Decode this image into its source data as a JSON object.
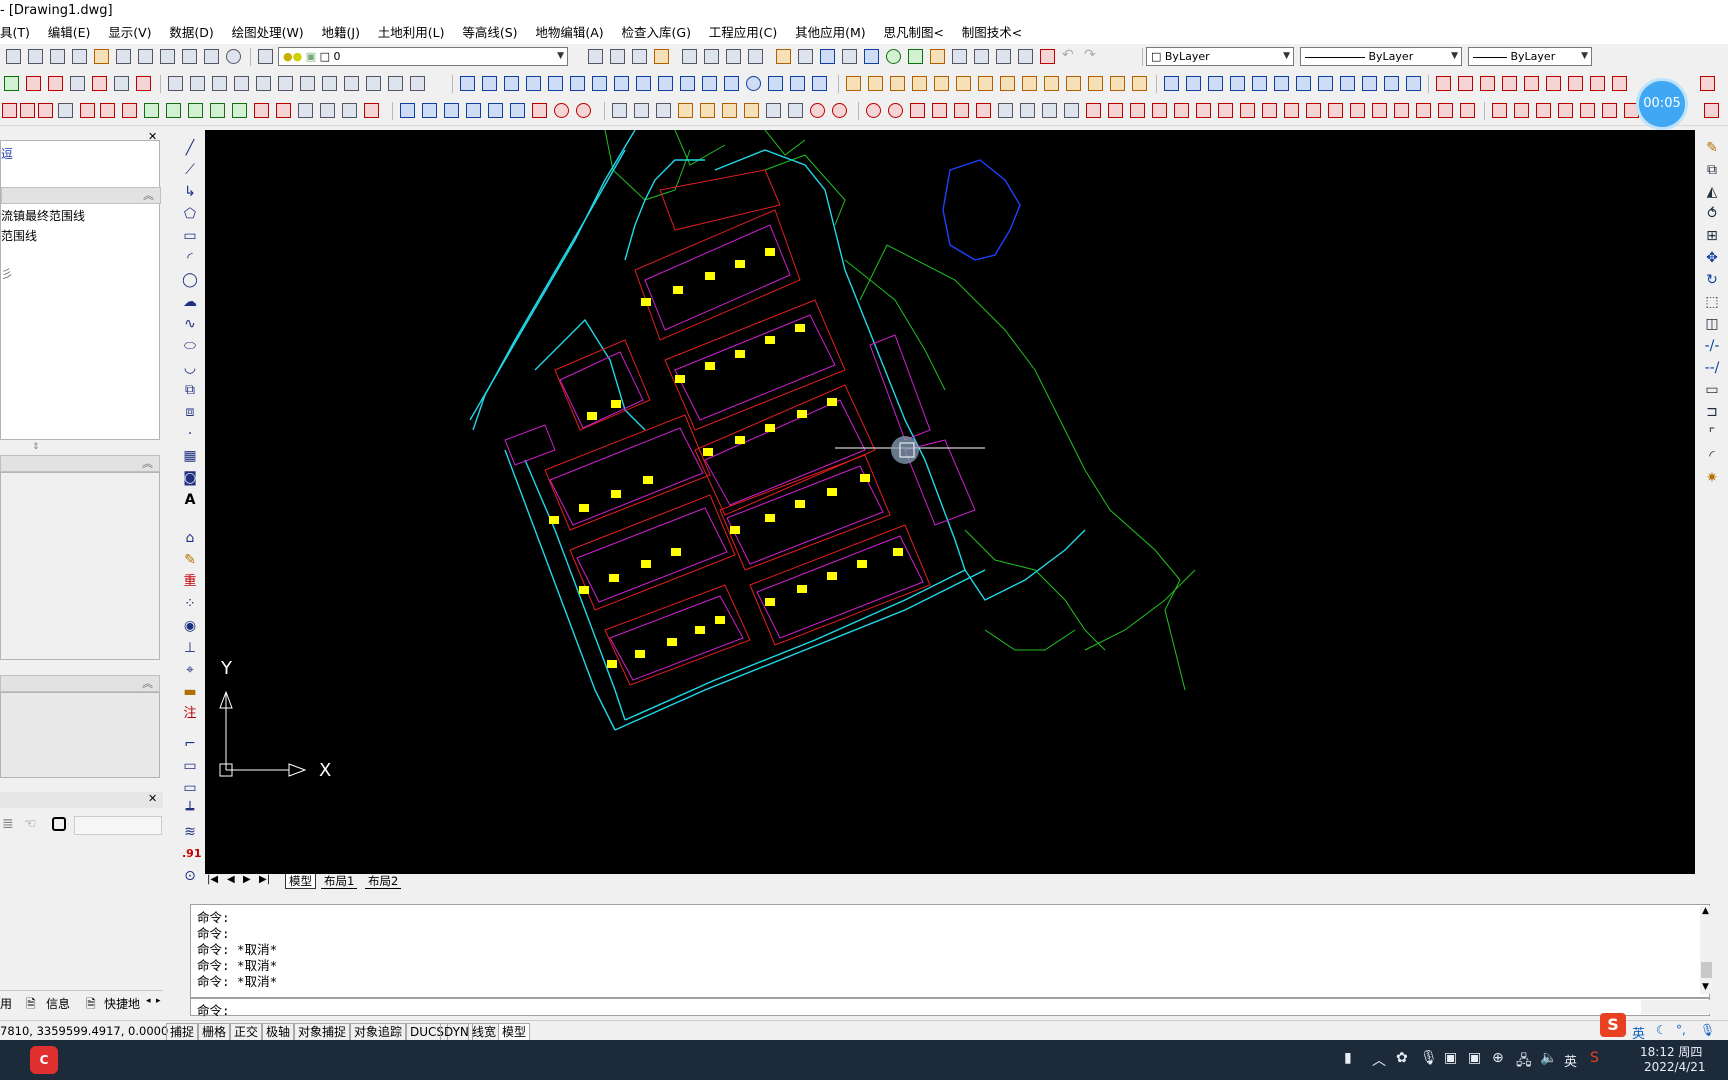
{
  "window": {
    "title": "- [Drawing1.dwg]"
  },
  "menu": [
    "具(T)",
    "编辑(E)",
    "显示(V)",
    "数据(D)",
    "绘图处理(W)",
    "地籍(J)",
    "土地利用(L)",
    "等高线(S)",
    "地物编辑(A)",
    "检查入库(G)",
    "工程应用(C)",
    "其他应用(M)",
    "思凡制图<",
    "制图技术<"
  ],
  "toolbar": {
    "layer_value": "0",
    "color_value": "ByLayer",
    "linetype_value": "ByLayer",
    "lineweight_value": "ByLayer"
  },
  "timer": "00:05",
  "left_panel": {
    "corner_label": "逗",
    "items": [
      "流镇最终范围线",
      "范围线",
      "彡"
    ]
  },
  "left_tools_text": {
    "heavy": "重",
    "note": "注",
    "num": ".91"
  },
  "axis": {
    "y": "Y",
    "x": "X"
  },
  "tabs": [
    "模型",
    "布局1",
    "布局2"
  ],
  "command": {
    "lines": [
      "命令:",
      "命令:",
      "命令: *取消*",
      "命令: *取消*",
      "命令: *取消*"
    ],
    "prompt": "命令:"
  },
  "panel_tabs": [
    "用",
    "信息",
    "快捷地"
  ],
  "status": {
    "coords": "7810, 3359599.4917, 0.0000",
    "toggles": [
      "捕捉",
      "栅格",
      "正交",
      "极轴",
      "对象捕捉",
      "对象追踪",
      "DUCS",
      "DYN",
      "线宽",
      "模型"
    ]
  },
  "taskbar": {
    "ime": "英",
    "time": "18:12 周四",
    "date": "2022/4/21"
  }
}
